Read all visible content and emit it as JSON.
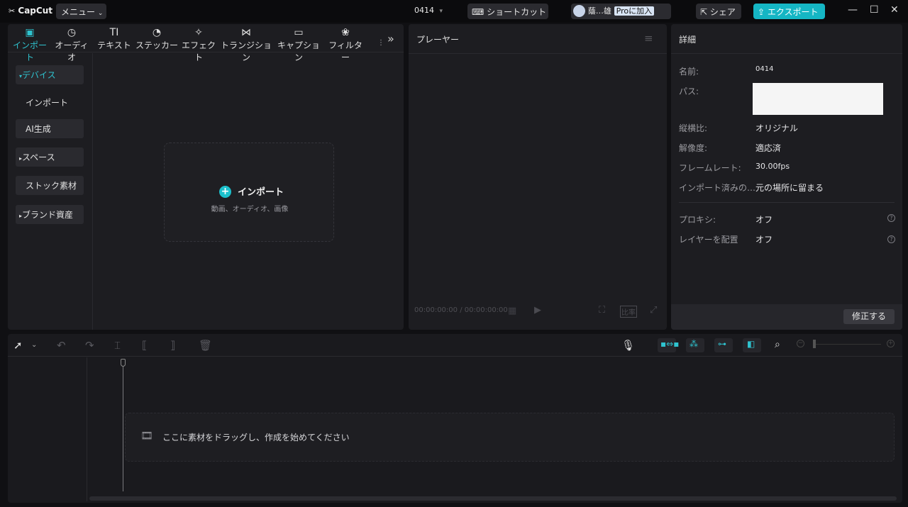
{
  "app": {
    "logo": "CapCut",
    "menu_label": "メニュー",
    "project_name": "0414"
  },
  "toolbar": {
    "shortcut_label": "ショートカット",
    "user_name": "蔭…雄",
    "pro_label": "Proに加入",
    "share_label": "シェア",
    "export_label": "エクスポート"
  },
  "media_tabs": [
    {
      "label": "インポート",
      "icon": "import-icon"
    },
    {
      "label": "オーディオ",
      "icon": "audio-icon"
    },
    {
      "label": "テキスト",
      "icon": "text-icon"
    },
    {
      "label": "ステッカー",
      "icon": "sticker-icon"
    },
    {
      "label": "エフェクト",
      "icon": "effect-icon"
    },
    {
      "label": "トランジション",
      "icon": "transition-icon"
    },
    {
      "label": "キャプション",
      "icon": "caption-icon"
    },
    {
      "label": "フィルター",
      "icon": "filter-icon"
    }
  ],
  "sidebar": {
    "items": [
      {
        "label": "デバイス",
        "expanded": true
      },
      {
        "label": "インポート"
      },
      {
        "label": "AI生成"
      },
      {
        "label": "スペース",
        "expanded": false
      },
      {
        "label": "ストック素材"
      },
      {
        "label": "ブランド資産",
        "expanded": false
      }
    ]
  },
  "import_box": {
    "title": "インポート",
    "subtitle": "動画、オーディオ、画像"
  },
  "player": {
    "title": "プレーヤー",
    "time_current": "00:00:00:00",
    "time_separator": "/",
    "time_total": "00:00:00:00",
    "ratio_label": "比率"
  },
  "details": {
    "title": "詳細",
    "rows": [
      {
        "label": "名前:",
        "value": "0414"
      },
      {
        "label": "パス:",
        "value": ""
      },
      {
        "label": "縦横比:",
        "value": "オリジナル"
      },
      {
        "label": "解像度:",
        "value": "適応済"
      },
      {
        "label": "フレームレート:",
        "value": "30.00fps"
      },
      {
        "label": "インポート済みの…",
        "value": "元の場所に留まる"
      }
    ],
    "toggles": [
      {
        "label": "プロキシ:",
        "value": "オフ"
      },
      {
        "label": "レイヤーを配置",
        "value": "オフ"
      }
    ],
    "modify_label": "修正する"
  },
  "timeline": {
    "drop_hint": "ここに素材をドラッグし、作成を始めてください"
  },
  "colors": {
    "accent": "#15b6c4",
    "panel": "#1d1d21",
    "background": "#101013"
  }
}
